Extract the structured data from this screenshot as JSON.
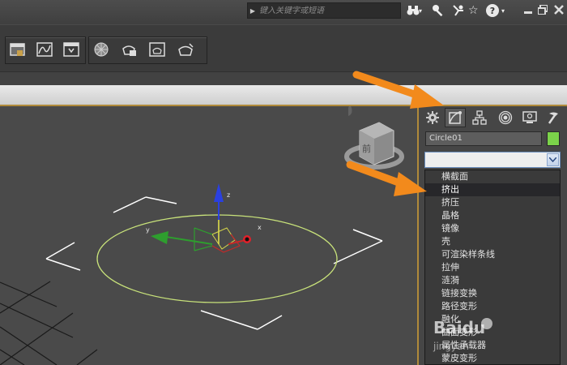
{
  "search": {
    "placeholder": "键入关键字或短语"
  },
  "top_icons": [
    "binoculars-icon",
    "key-icon",
    "star-search-icon",
    "star-icon",
    "help-icon"
  ],
  "help_symbol": "?",
  "viewcube": {
    "label": "前"
  },
  "viewport": {
    "axis_labels": {
      "x": "x",
      "y": "y",
      "z": "z"
    },
    "spline_color": "#c8e27a",
    "gizmo_colors": {
      "x": "#e0202a",
      "y": "#2e9e2e",
      "z": "#2a40e0"
    }
  },
  "command_panel": {
    "object_name": "Circle01",
    "object_color": "#7bd24a",
    "modifier_list": {
      "selected_value": "",
      "items": [
        "横截面",
        "挤出",
        "挤压",
        "晶格",
        "镜像",
        "壳",
        "可渲染样条线",
        "拉伸",
        "涟漪",
        "链接变换",
        "路径变形",
        "融化",
        "曲面变形",
        "属性承载器",
        "蒙皮变形"
      ],
      "highlighted_index": 1
    }
  },
  "annotation_color": "#f28a1c",
  "watermark": {
    "brand": "Baidu",
    "site": "jingyan"
  }
}
